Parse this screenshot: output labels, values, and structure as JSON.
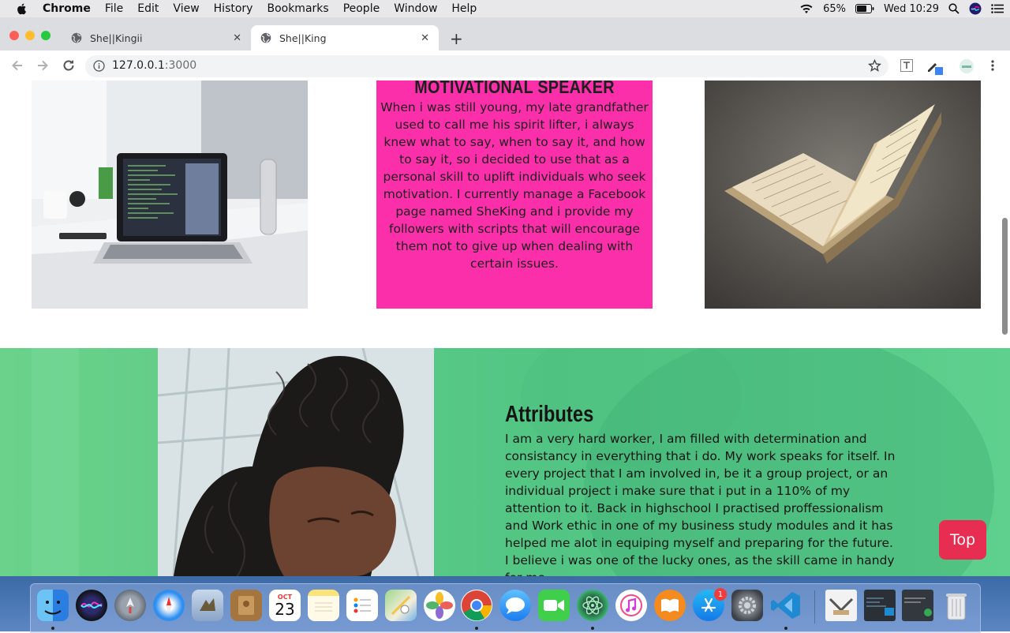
{
  "menubar": {
    "items": [
      "Chrome",
      "File",
      "Edit",
      "View",
      "History",
      "Bookmarks",
      "People",
      "Window",
      "Help"
    ],
    "battery": "65%",
    "clock": "Wed 10:29"
  },
  "tabs": [
    {
      "title": "She||Kingii"
    },
    {
      "title": "She||King"
    }
  ],
  "address": {
    "host": "127.0.0.1",
    "port": ":3000"
  },
  "cards": {
    "speaker_title": "MOTIVATIONAL SPEAKER",
    "speaker_text": "When i was still young, my late grandfather used to call me his spirit lifter, i always knew what to say, when to say it, and how to say it, so i decided to use that as a personal skill to uplift individuals who seek motivation. I currently manage a Facebook page named SheKing and i provide my followers with scripts that will encourage them not to give up when dealing with certain issues."
  },
  "attributes": {
    "title": "Attributes",
    "text": "I am a very hard worker, I am filled with determination and consistancy in everything that i do. My work speaks for itself. In every project that I am involved in, be it a group project, or an individual project i make sure that i put in a 110% of my attention to it. Back in highschool I practised proffessionalism and Work ethic in one of my business study modules and it has helped me alot in equiping myself and preparing for the future. I believe i was one of the lucky ones, as the skill came in handy for me."
  },
  "top_button": "Top",
  "dock": {
    "calendar_month": "OCT",
    "calendar_day": "23",
    "appstore_badge": "1"
  },
  "colors": {
    "pink_card": "#fb2fa9",
    "green_section": "#5bd38a",
    "top_button": "#e72d52"
  }
}
